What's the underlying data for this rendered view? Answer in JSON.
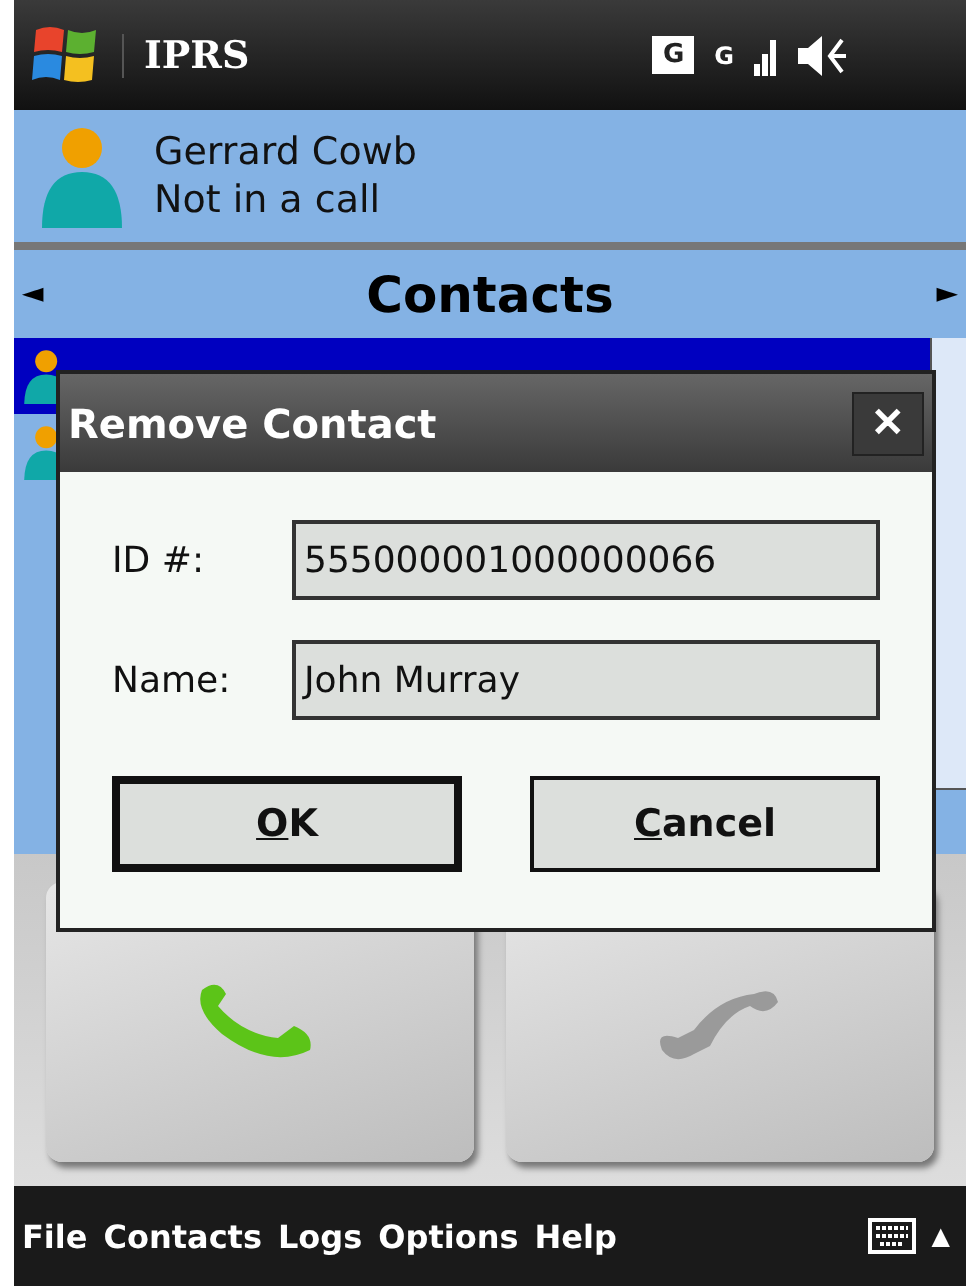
{
  "status_bar": {
    "title": "IPRS",
    "network_badge": "G",
    "signal_badge": "G"
  },
  "profile": {
    "name": "Gerrard Cowb",
    "status": "Not in a call"
  },
  "header": {
    "title": "Contacts",
    "left_arrow": "◄",
    "right_arrow": "►"
  },
  "contacts": [
    {
      "selected": true
    },
    {
      "selected": false
    }
  ],
  "dialog": {
    "title": "Remove Contact",
    "close": "✕",
    "fields": [
      {
        "label": "ID #:",
        "value": "555000001000000066"
      },
      {
        "label": "Name:",
        "value": "John Murray"
      }
    ],
    "buttons": [
      {
        "label": "OK",
        "default": true
      },
      {
        "label": "Cancel",
        "default": false
      }
    ]
  },
  "calls": [
    {
      "kind": "answer"
    },
    {
      "kind": "hangup"
    }
  ],
  "menu": [
    "File",
    "Contacts",
    "Logs",
    "Options",
    "Help"
  ],
  "menu_arrow": "▲"
}
